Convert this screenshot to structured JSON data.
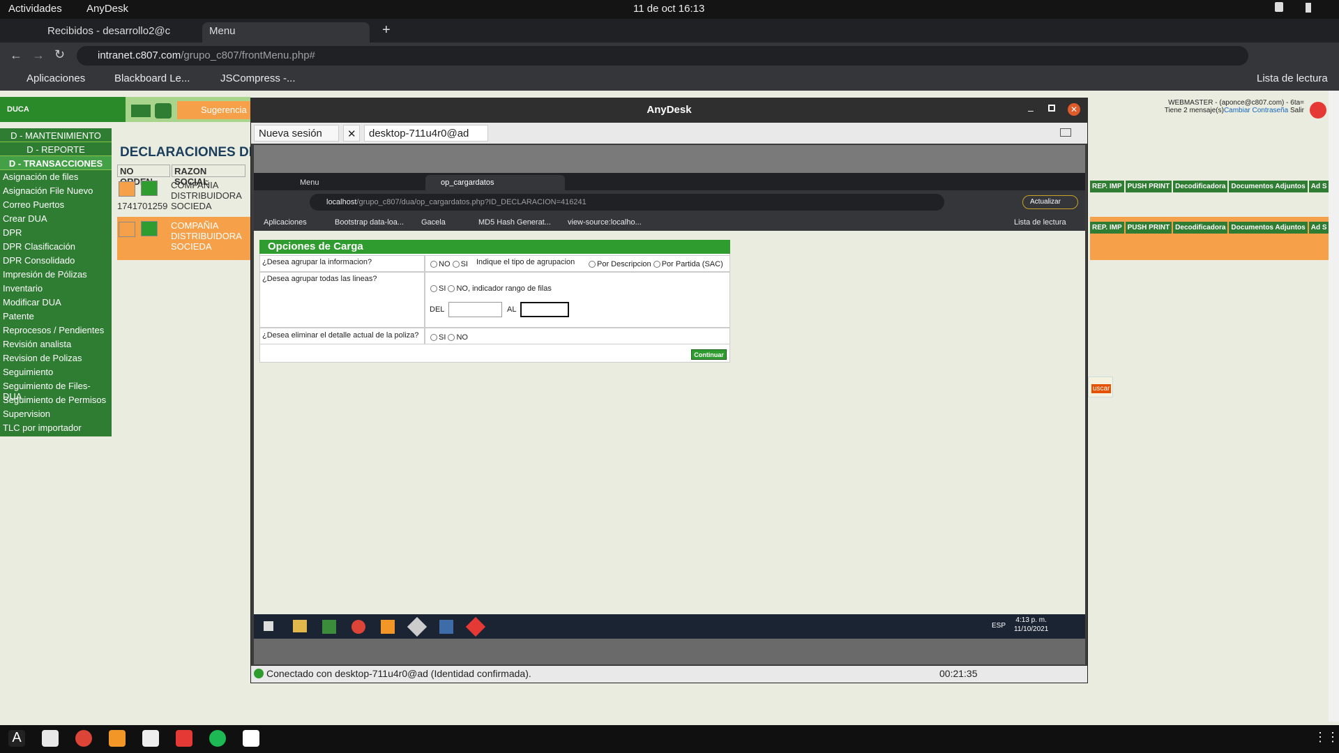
{
  "system": {
    "activities": "Actividades",
    "app": "AnyDesk",
    "datetime": "11 de oct  16:13"
  },
  "browser": {
    "tabs": [
      "Recibidos - desarrollo2@c",
      "Menu"
    ],
    "url_host": "intranet.c807.com",
    "url_path": "/grupo_c807/frontMenu.php#",
    "bookmarks": [
      "Aplicaciones",
      "Blackboard Le...",
      "JSCompress -..."
    ],
    "reading_list": "Lista de lectura"
  },
  "page": {
    "duca": "DUCA",
    "sugerencia": "Sugerencia",
    "title": "DECLARACIONES DE",
    "user_line1": "WEBMASTER - (aponce@c807.com) - 6ta=",
    "user_line2": "Tiene 2 mensaje(s)",
    "change_pw": "Cambiar Contraseña",
    "logout": "Salir",
    "sidebar_heads": [
      "D - MANTENIMIENTO",
      "D - REPORTE",
      "D - TRANSACCIONES"
    ],
    "sidebar_items": [
      "Asignación de files",
      "Asignación File Nuevo",
      "Correo Puertos",
      "Crear DUA",
      "DPR",
      "DPR Clasificación",
      "DPR Consolidado",
      "Impresión de Pólizas",
      "Inventario",
      "Modificar DUA",
      "Patente",
      "Reprocesos / Pendientes",
      "Revisión analista",
      "Revision de Polizas",
      "Seguimiento",
      "Seguimiento de Files-DUA",
      "Seguimiento de Permisos",
      "Supervision",
      "TLC por importador"
    ],
    "col_headers": [
      "NO ORDEN",
      "RAZON SOCIAL"
    ],
    "row1_order": "1741701259",
    "row_company": "COMPAÑIA DISTRIBUIDORA SOCIEDA",
    "row_tags": [
      "REP. IMP",
      "PUSH PRINT",
      "Decodificadora",
      "Documentos Adjuntos",
      "Ad S"
    ],
    "buscar": "uscar"
  },
  "anydesk": {
    "title": "AnyDesk",
    "new_session": "Nueva sesión",
    "session_tab": "desktop-711u4r0@ad",
    "status": "Conectado con desktop-711u4r0@ad (Identidad confirmada).",
    "timer": "00:21:35"
  },
  "remote": {
    "tabs": [
      "Menu",
      "op_cargardatos"
    ],
    "url_host": "localhost",
    "url_path": "/grupo_c807/dua/op_cargardatos.php?ID_DECLARACION=416241",
    "update": "Actualizar",
    "bookmarks": [
      "Aplicaciones",
      "Bootstrap data-loa...",
      "Gacela",
      "MD5 Hash Generat...",
      "view-source:localho..."
    ],
    "reading_list": "Lista de lectura",
    "clock_time": "4:13 p. m.",
    "clock_date": "11/10/2021",
    "lang": "ESP"
  },
  "form": {
    "header": "Opciones de Carga",
    "q1": "¿Desea agrupar la informacion?",
    "q1_no": "NO",
    "q1_si": "SI",
    "q1_hint": "Indique el tipo de agrupacion",
    "opt_desc": "Por Descripcion",
    "opt_partida": "Por Partida (SAC)",
    "q2": "¿Desea agrupar todas las lineas?",
    "q2_si": "SI",
    "q2_no": "NO, indicador rango de filas",
    "del": "DEL",
    "al": "AL",
    "q3": "¿Desea eliminar el detalle actual de la poliza?",
    "q3_si": "SI",
    "q3_no": "NO",
    "continue": "Continuar"
  }
}
